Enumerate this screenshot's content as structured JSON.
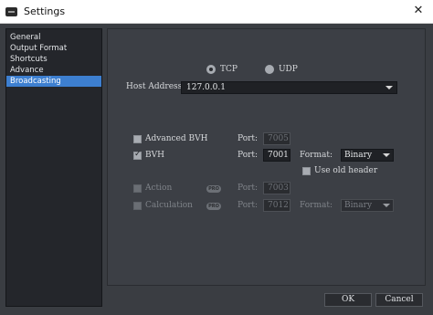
{
  "window": {
    "title": "Settings"
  },
  "sidebar": {
    "items": [
      {
        "label": "General",
        "active": false
      },
      {
        "label": "Output Format",
        "active": false
      },
      {
        "label": "Shortcuts",
        "active": false
      },
      {
        "label": "Advance",
        "active": false
      },
      {
        "label": "Broadcasting",
        "active": true
      }
    ]
  },
  "protocol": {
    "options": [
      {
        "label": "TCP",
        "selected": true
      },
      {
        "label": "UDP",
        "selected": false
      }
    ]
  },
  "host": {
    "label": "Host Address:",
    "value": "127.0.0.1"
  },
  "streams": {
    "port_label": "Port:",
    "format_label": "Format:",
    "pro_badge": "PRO",
    "advanced_bvh": {
      "label": "Advanced BVH",
      "checked": false,
      "enabled": true,
      "port": "7005"
    },
    "bvh": {
      "label": "BVH",
      "checked": true,
      "enabled": true,
      "port": "7001",
      "format": "Binary",
      "use_old_header_label": "Use old header",
      "use_old_header_checked": false
    },
    "action": {
      "label": "Action",
      "checked": false,
      "enabled": false,
      "port": "7003"
    },
    "calculation": {
      "label": "Calculation",
      "checked": false,
      "enabled": false,
      "port": "7012",
      "format": "Binary"
    }
  },
  "footer": {
    "ok_label": "OK",
    "cancel_label": "Cancel"
  },
  "colors": {
    "accent": "#3d7fd0",
    "panel": "#3c3f45",
    "sidebar": "#24262b"
  }
}
